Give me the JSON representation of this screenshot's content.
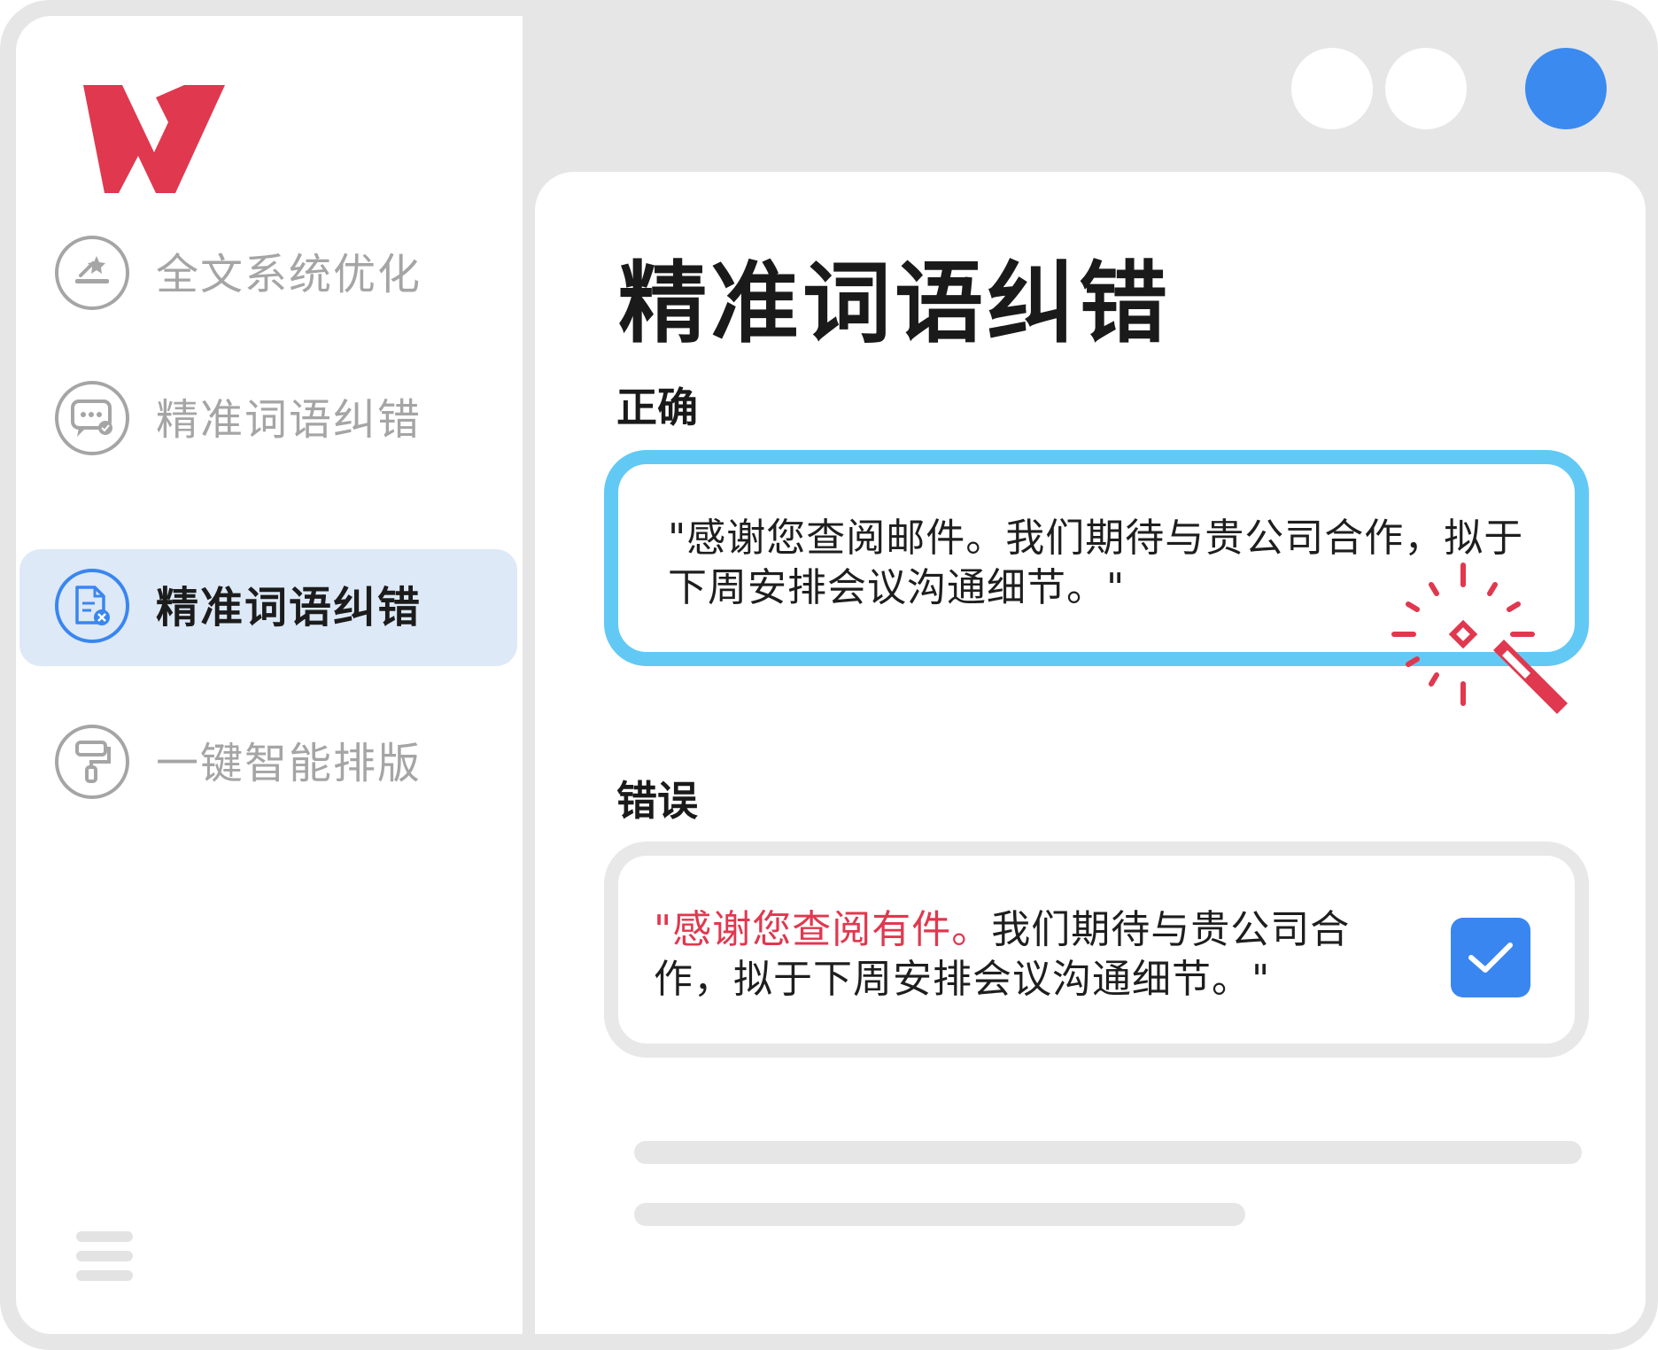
{
  "app": {
    "logo_icon": "wps-logo",
    "brand_color": "#e0384f",
    "accent_color": "#3a86f0"
  },
  "window_controls": [
    {
      "icon": "window-dot",
      "color": "#ffffff"
    },
    {
      "icon": "window-dot",
      "color": "#ffffff"
    },
    {
      "icon": "window-dot-active",
      "color": "#3a8af0"
    }
  ],
  "sidebar": {
    "items": [
      {
        "label": "全文系统优化",
        "icon": "magic-wand-doc-icon",
        "active": false
      },
      {
        "label": "精准词语纠错",
        "icon": "chat-bubble-icon",
        "active": false
      },
      {
        "label": "精准词语纠错",
        "icon": "document-error-icon",
        "active": true
      },
      {
        "label": "一键智能排版",
        "icon": "paint-roller-icon",
        "active": false
      }
    ],
    "menu_icon": "hamburger-icon"
  },
  "main": {
    "title": "精准词语纠错",
    "correct": {
      "label": "正确",
      "text": "\"感谢您查阅邮件。我们期待与贵公司合作，拟于下周安排会议沟通细节。\"",
      "border_color": "#62c9f5",
      "icon": "magic-wand-icon"
    },
    "wrong": {
      "label": "错误",
      "text_error": "\"感谢您查阅有件。",
      "text_rest": "我们期待与贵公司合作，拟于下周安排会议沟通细节。\"",
      "error_color": "#e0384f",
      "checkbox_checked": true
    }
  }
}
